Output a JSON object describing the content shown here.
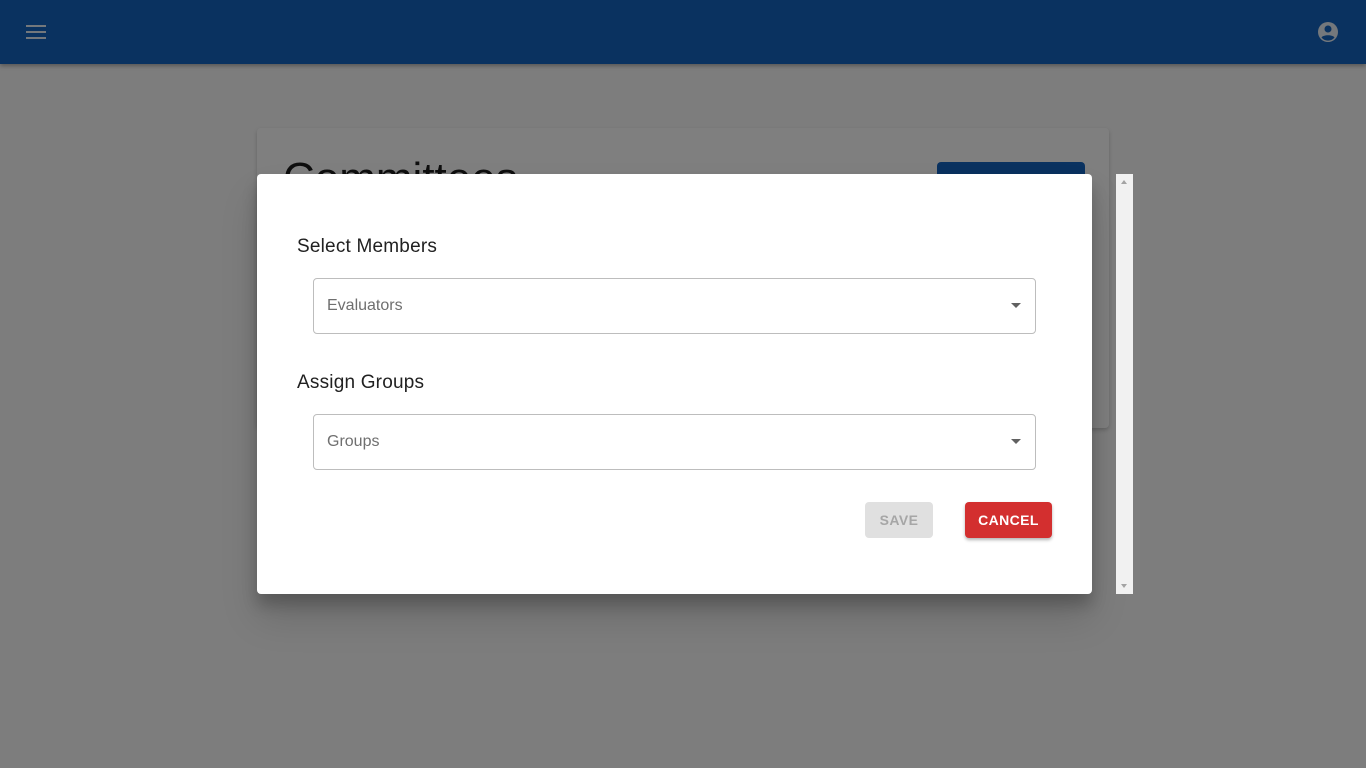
{
  "appbar": {
    "menu_icon": "menu-icon",
    "account_icon": "account-circle-icon",
    "color": "#1565c0"
  },
  "background_page": {
    "title": "Committees"
  },
  "dialog": {
    "members_section_title": "Select Members",
    "evaluators_select": {
      "placeholder": "Evaluators",
      "value": ""
    },
    "groups_section_title": "Assign Groups",
    "groups_select": {
      "placeholder": "Groups",
      "value": ""
    },
    "save_label": "SAVE",
    "save_disabled": true,
    "cancel_label": "CANCEL",
    "cancel_color": "#d32f2f"
  },
  "scrollbar": {
    "up_icon": "scroll-up-arrow-icon",
    "down_icon": "scroll-down-arrow-icon"
  }
}
